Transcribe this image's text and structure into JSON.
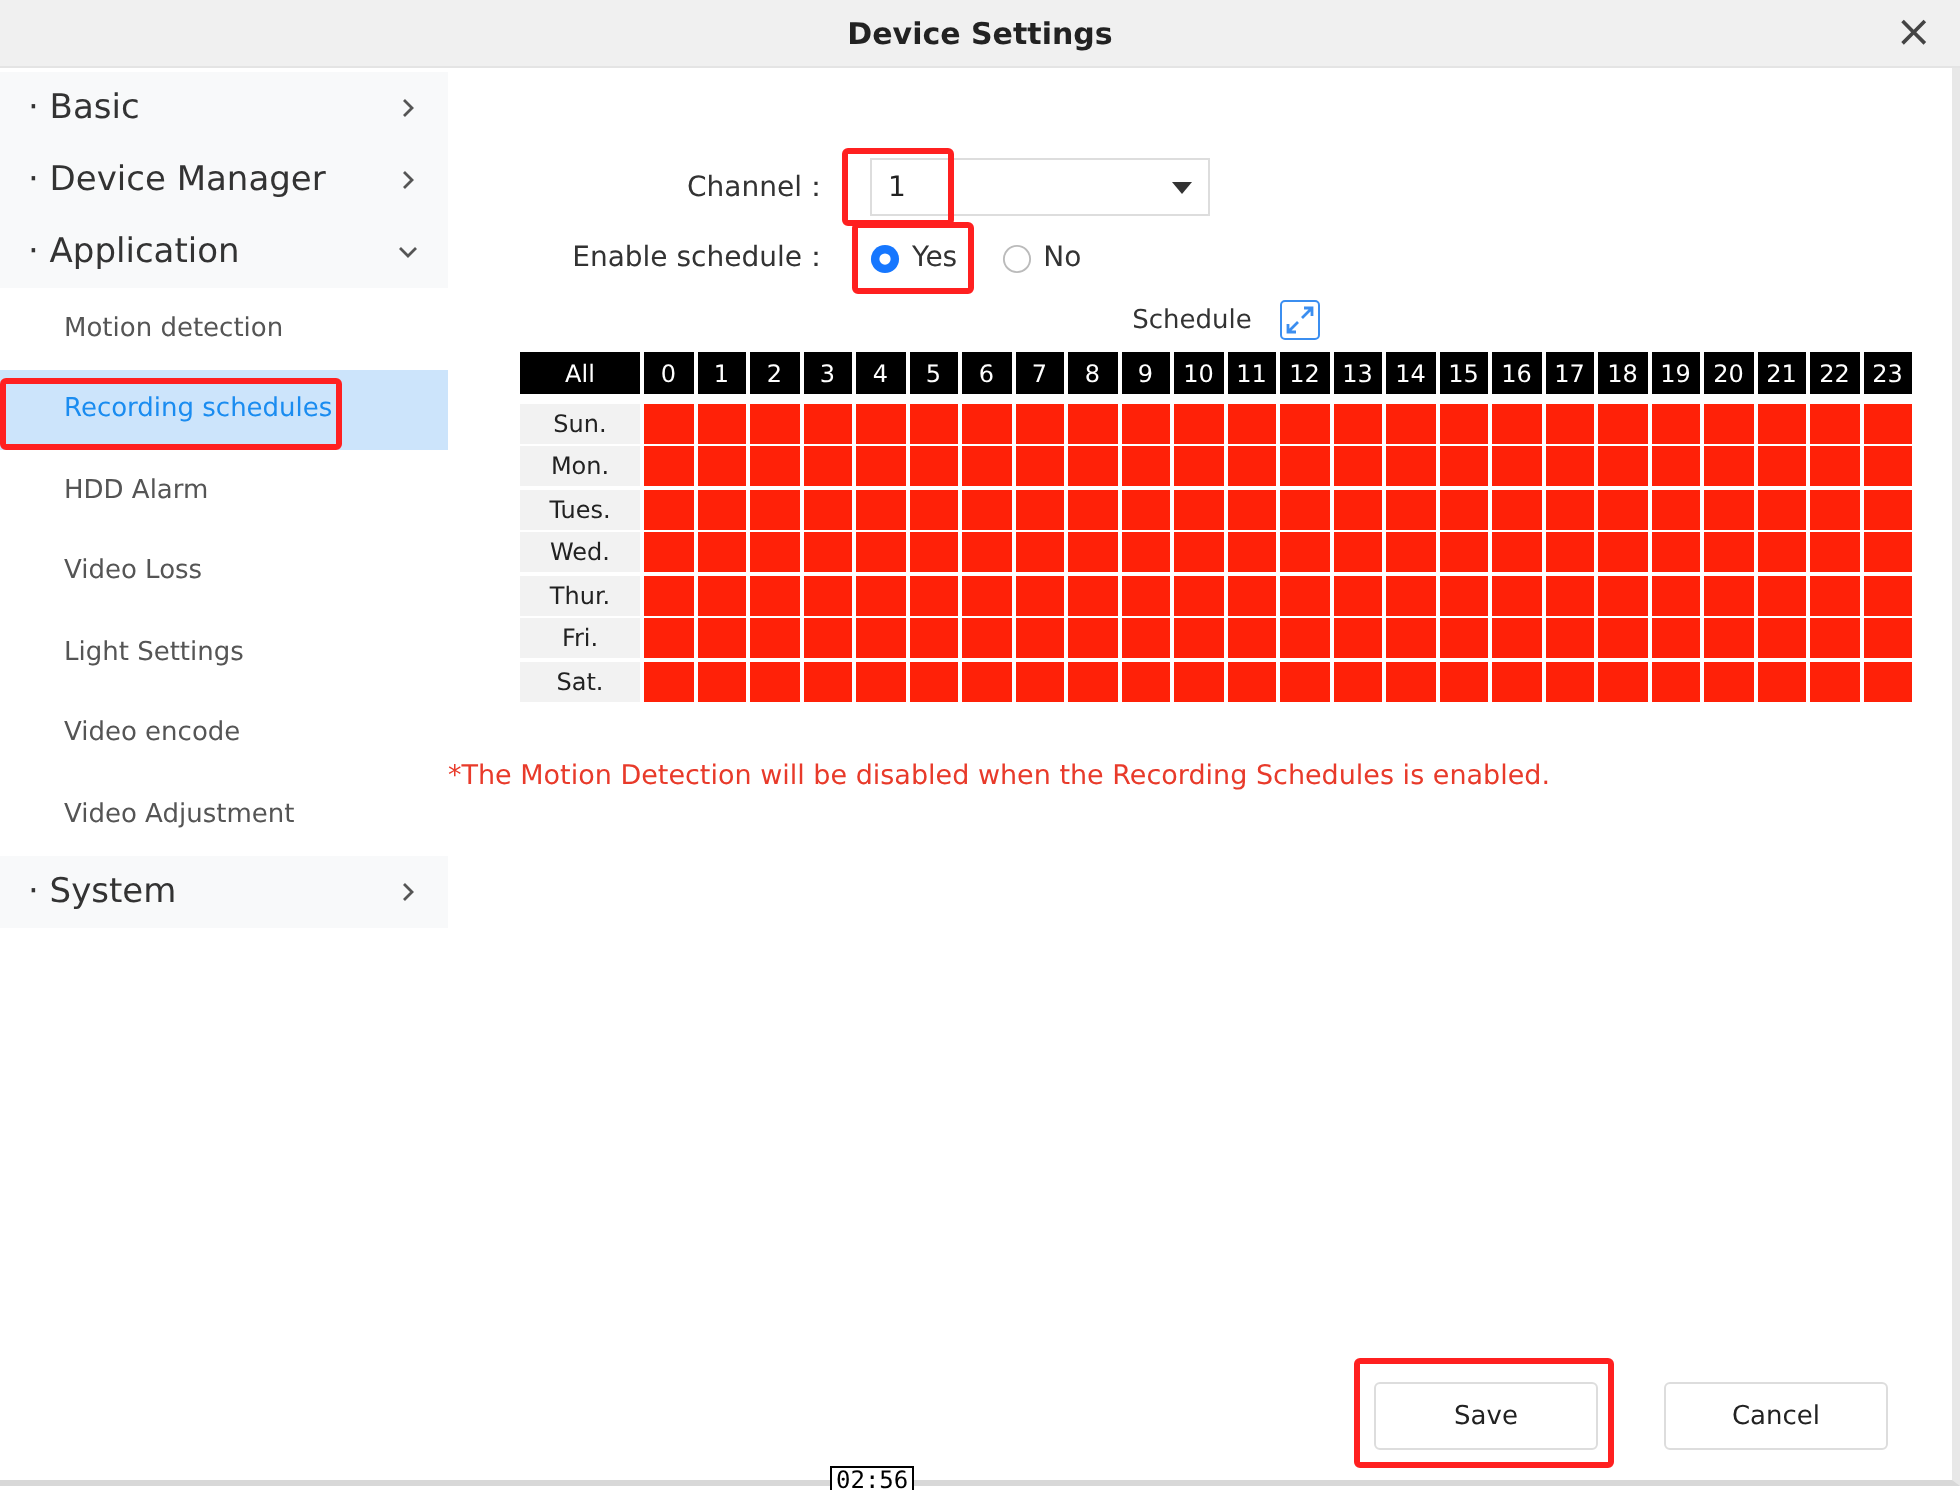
{
  "window": {
    "title": "Device Settings",
    "close": "×"
  },
  "sidebar": {
    "sections": [
      {
        "label": "· Basic",
        "expanded": false
      },
      {
        "label": "· Device Manager",
        "expanded": false
      },
      {
        "label": "· Application",
        "expanded": true,
        "children": [
          {
            "label": "Motion detection",
            "selected": false,
            "highlighted": false
          },
          {
            "label": "Recording schedules",
            "selected": true,
            "highlighted": true
          },
          {
            "label": "HDD Alarm",
            "selected": false,
            "highlighted": false
          },
          {
            "label": "Video Loss",
            "selected": false,
            "highlighted": false
          },
          {
            "label": "Light Settings",
            "selected": false,
            "highlighted": false
          },
          {
            "label": "Video encode",
            "selected": false,
            "highlighted": false
          },
          {
            "label": "Video Adjustment",
            "selected": false,
            "highlighted": false
          }
        ]
      },
      {
        "label": "· System",
        "expanded": false
      }
    ]
  },
  "channel": {
    "label": "Channel：",
    "value": "1",
    "highlighted": true
  },
  "enable_schedule": {
    "label": "Enable schedule：",
    "options": [
      {
        "label": "Yes",
        "selected": true,
        "highlighted": true
      },
      {
        "label": "No",
        "selected": false,
        "highlighted": false
      }
    ]
  },
  "schedule": {
    "title": "Schedule",
    "all": "All",
    "hours": [
      "0",
      "1",
      "2",
      "3",
      "4",
      "5",
      "6",
      "7",
      "8",
      "9",
      "10",
      "11",
      "12",
      "13",
      "14",
      "15",
      "16",
      "17",
      "18",
      "19",
      "20",
      "21",
      "22",
      "23"
    ],
    "days": [
      {
        "label": "Sun.",
        "slots": [
          true,
          true,
          true,
          true,
          true,
          true,
          true,
          true,
          true,
          true,
          true,
          true,
          true,
          true,
          true,
          true,
          true,
          true,
          true,
          true,
          true,
          true,
          true,
          true
        ]
      },
      {
        "label": "Mon.",
        "slots": [
          true,
          true,
          true,
          true,
          true,
          true,
          true,
          true,
          true,
          true,
          true,
          true,
          true,
          true,
          true,
          true,
          true,
          true,
          true,
          true,
          true,
          true,
          true,
          true
        ]
      },
      {
        "label": "Tues.",
        "slots": [
          true,
          true,
          true,
          true,
          true,
          true,
          true,
          true,
          true,
          true,
          true,
          true,
          true,
          true,
          true,
          true,
          true,
          true,
          true,
          true,
          true,
          true,
          true,
          true
        ]
      },
      {
        "label": "Wed.",
        "slots": [
          true,
          true,
          true,
          true,
          true,
          true,
          true,
          true,
          true,
          true,
          true,
          true,
          true,
          true,
          true,
          true,
          true,
          true,
          true,
          true,
          true,
          true,
          true,
          true
        ]
      },
      {
        "label": "Thur.",
        "slots": [
          true,
          true,
          true,
          true,
          true,
          true,
          true,
          true,
          true,
          true,
          true,
          true,
          true,
          true,
          true,
          true,
          true,
          true,
          true,
          true,
          true,
          true,
          true,
          true
        ]
      },
      {
        "label": "Fri.",
        "slots": [
          true,
          true,
          true,
          true,
          true,
          true,
          true,
          true,
          true,
          true,
          true,
          true,
          true,
          true,
          true,
          true,
          true,
          true,
          true,
          true,
          true,
          true,
          true,
          true
        ]
      },
      {
        "label": "Sat.",
        "slots": [
          true,
          true,
          true,
          true,
          true,
          true,
          true,
          true,
          true,
          true,
          true,
          true,
          true,
          true,
          true,
          true,
          true,
          true,
          true,
          true,
          true,
          true,
          true,
          true
        ]
      }
    ]
  },
  "notice": "*The Motion Detection will be disabled when the Recording Schedules is enabled.",
  "buttons": [
    {
      "label": "Save",
      "highlighted": true
    },
    {
      "label": "Cancel",
      "highlighted": false
    }
  ],
  "timestamp": "02:56"
}
